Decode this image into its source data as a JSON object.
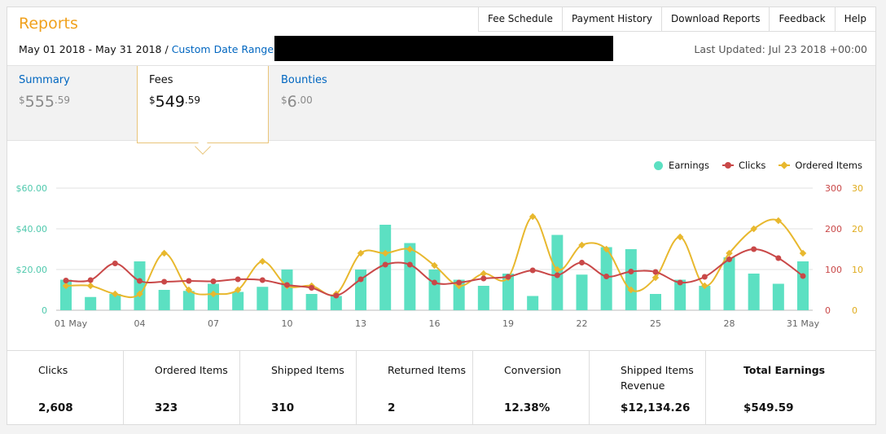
{
  "header": {
    "title": "Reports",
    "nav": [
      "Fee Schedule",
      "Payment History",
      "Download Reports",
      "Feedback",
      "Help"
    ]
  },
  "daterange": {
    "dates": "May 01 2018 - May 31 2018",
    "separator": "/",
    "custom_label": "Custom Date Range"
  },
  "last_updated": "Last Updated: Jul 23 2018 +00:00",
  "tabs": [
    {
      "label": "Summary",
      "currency": "$",
      "whole": "555",
      "cents": ".59",
      "active": false
    },
    {
      "label": "Fees",
      "currency": "$",
      "whole": "549",
      "cents": ".59",
      "active": true
    },
    {
      "label": "Bounties",
      "currency": "$",
      "whole": "6",
      "cents": ".00",
      "active": false
    }
  ],
  "legend": [
    {
      "label": "Earnings",
      "color": "#5ce0c2"
    },
    {
      "label": "Clicks",
      "color": "#c94848"
    },
    {
      "label": "Ordered Items",
      "color": "#e8b82e"
    }
  ],
  "chart_data": {
    "type": "bar",
    "x": [
      "01 May",
      "02 May",
      "03 May",
      "04 May",
      "05 May",
      "06 May",
      "07 May",
      "08 May",
      "09 May",
      "10 May",
      "11 May",
      "12 May",
      "13 May",
      "14 May",
      "15 May",
      "16 May",
      "17 May",
      "18 May",
      "19 May",
      "20 May",
      "21 May",
      "22 May",
      "23 May",
      "24 May",
      "25 May",
      "26 May",
      "27 May",
      "28 May",
      "29 May",
      "30 May",
      "31 May"
    ],
    "x_tick_labels": [
      "01 May",
      "04",
      "07",
      "10",
      "13",
      "16",
      "19",
      "22",
      "25",
      "28",
      "31 May"
    ],
    "x_tick_index": [
      0,
      3,
      6,
      9,
      12,
      15,
      18,
      21,
      24,
      27,
      30
    ],
    "series": [
      {
        "name": "Earnings",
        "axis": "left",
        "render": "bar",
        "color": "#5ce0c2",
        "values": [
          15,
          6.5,
          8,
          24,
          10,
          9.5,
          13,
          9,
          11.5,
          20,
          8,
          7,
          20,
          42,
          33,
          20,
          15,
          12,
          18,
          7,
          37,
          17.5,
          31,
          30,
          8,
          15,
          12,
          26,
          18,
          13,
          24
        ]
      },
      {
        "name": "Clicks",
        "axis": "right",
        "render": "line",
        "color": "#c94848",
        "values": [
          73,
          74,
          115,
          72,
          70,
          72,
          71,
          76,
          74,
          62,
          55,
          36,
          76,
          112,
          112,
          68,
          68,
          78,
          82,
          98,
          86,
          117,
          83,
          95,
          94,
          68,
          82,
          125,
          150,
          128,
          84
        ]
      },
      {
        "name": "Ordered Items",
        "axis": "right2",
        "render": "line",
        "color": "#e8b82e",
        "values": [
          6,
          6,
          4,
          4,
          14,
          5,
          4,
          5,
          12,
          6,
          6,
          4,
          14,
          14,
          15,
          11,
          6,
          9,
          8,
          23,
          10,
          16,
          15,
          5,
          8,
          18,
          6,
          14,
          20,
          22,
          14
        ]
      }
    ],
    "y_left": {
      "ticks": [
        "0",
        "$20.00",
        "$40.00",
        "$60.00"
      ],
      "range": [
        0,
        60
      ]
    },
    "y_right": {
      "ticks": [
        "0",
        "100",
        "200",
        "300"
      ],
      "range": [
        0,
        300
      ]
    },
    "y_right2": {
      "ticks": [
        "0",
        "10",
        "20",
        "30"
      ],
      "range": [
        0,
        30
      ]
    },
    "grid": true,
    "legend_position": "top-right"
  },
  "stats": [
    {
      "label": "Clicks",
      "value": "2,608"
    },
    {
      "label": "Ordered Items",
      "value": "323"
    },
    {
      "label": "Shipped Items",
      "value": "310"
    },
    {
      "label": "Returned Items",
      "value": "2"
    },
    {
      "label": "Conversion",
      "value": "12.38%"
    },
    {
      "label": "Shipped Items Revenue",
      "value": "$12,134.26"
    },
    {
      "label": "Total Earnings",
      "value": "$549.59"
    }
  ]
}
